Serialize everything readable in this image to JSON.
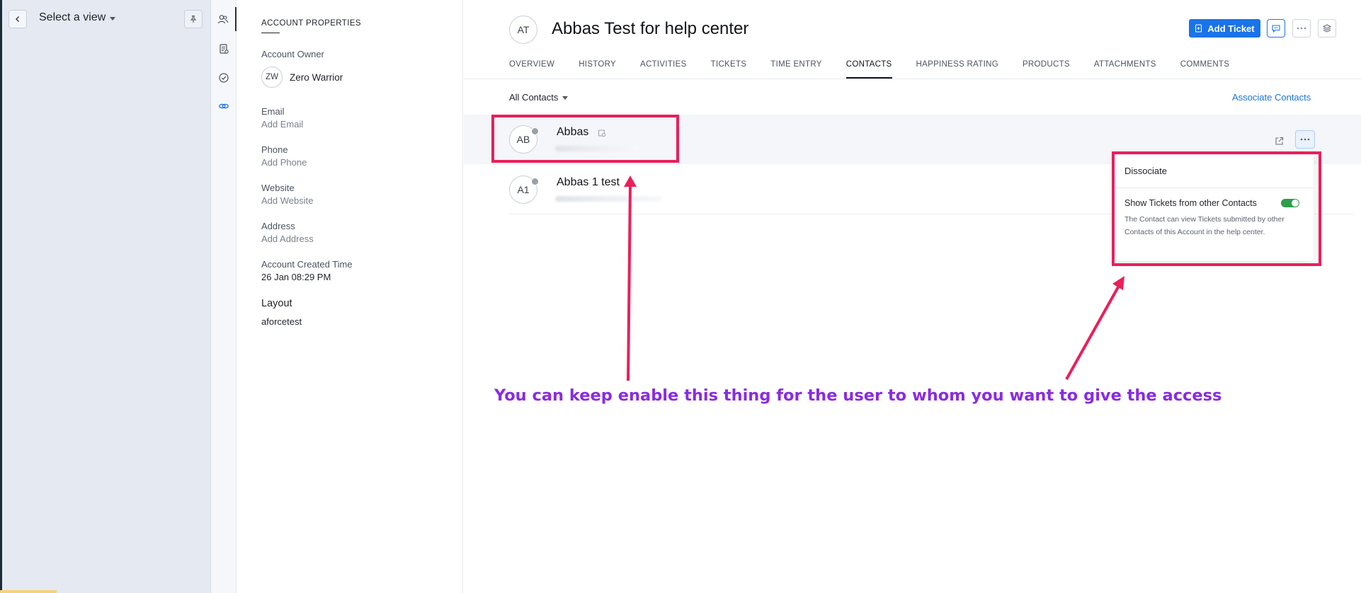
{
  "view_panel": {
    "title": "Select a view"
  },
  "rail": {
    "items": [
      "contacts-icon",
      "ticket-list-icon",
      "check-circle-icon",
      "link-icon"
    ]
  },
  "account_properties": {
    "heading": "ACCOUNT PROPERTIES",
    "owner_label": "Account Owner",
    "owner_initials": "ZW",
    "owner_name": "Zero Warrior",
    "email_label": "Email",
    "email_value": "Add Email",
    "phone_label": "Phone",
    "phone_value": "Add Phone",
    "website_label": "Website",
    "website_value": "Add Website",
    "address_label": "Address",
    "address_value": "Add Address",
    "created_label": "Account Created Time",
    "created_value": "26 Jan 08:29 PM",
    "layout_label": "Layout",
    "layout_value": "aforcetest"
  },
  "header": {
    "initials": "AT",
    "title": "Abbas Test for help center",
    "add_ticket_label": "Add Ticket"
  },
  "tabs": [
    {
      "label": "OVERVIEW"
    },
    {
      "label": "HISTORY"
    },
    {
      "label": "ACTIVITIES"
    },
    {
      "label": "TICKETS"
    },
    {
      "label": "TIME ENTRY"
    },
    {
      "label": "CONTACTS",
      "active": true
    },
    {
      "label": "HAPPINESS RATING"
    },
    {
      "label": "PRODUCTS"
    },
    {
      "label": "ATTACHMENTS"
    },
    {
      "label": "COMMENTS"
    }
  ],
  "contacts": {
    "filter_label": "All Contacts",
    "associate_label": "Associate Contacts",
    "rows": [
      {
        "initials": "AB",
        "name": "Abbas"
      },
      {
        "initials": "A1",
        "name": "Abbas 1 test"
      }
    ]
  },
  "dropdown": {
    "dissociate_label": "Dissociate",
    "toggle_label": "Show Tickets from other Contacts",
    "toggle_on": true,
    "description": "The Contact can view Tickets submitted by other Contacts of this Account in the help center."
  },
  "annotation": {
    "text": "You can keep enable this thing for the user to whom you want to give the access"
  },
  "colors": {
    "accent": "#1a73e8",
    "highlight": "#ea1f5b",
    "annotation": "#8a2be2",
    "toggle_on": "#2e9e4a"
  }
}
